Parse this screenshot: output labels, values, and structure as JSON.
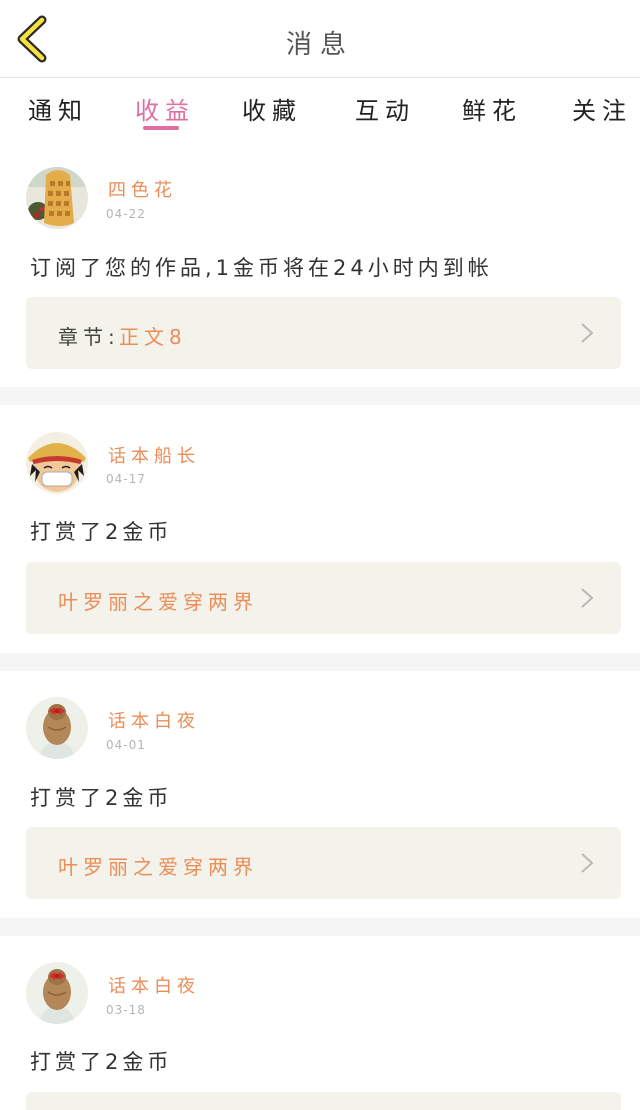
{
  "header": {
    "title": "消息"
  },
  "tabs": [
    {
      "label": "通知",
      "active": false
    },
    {
      "label": "收益",
      "active": true
    },
    {
      "label": "收藏",
      "active": false
    },
    {
      "label": "互动",
      "active": false
    },
    {
      "label": "鲜花",
      "active": false
    },
    {
      "label": "关注",
      "active": false
    }
  ],
  "messages": [
    {
      "user": "四色花",
      "date": "04-22",
      "text": "订阅了您的作品,1金币将在24小时内到帐",
      "link_prefix": "章节:",
      "link_text": "正文8",
      "avatar": "waffle-avatar"
    },
    {
      "user": "话本船长",
      "date": "04-17",
      "text": "打赏了2金币",
      "link_prefix": "",
      "link_text": "叶罗丽之爱穿两界",
      "avatar": "cartoon-boy-avatar"
    },
    {
      "user": "话本白夜",
      "date": "04-01",
      "text": "打赏了2金币",
      "link_prefix": "",
      "link_text": "叶罗丽之爱穿两界",
      "avatar": "girl-bun-avatar"
    },
    {
      "user": "话本白夜",
      "date": "03-18",
      "text": "打赏了2金币",
      "link_prefix": "",
      "link_text": "",
      "avatar": "girl-bun-avatar"
    }
  ],
  "colors": {
    "accent_pink": "#e06ea0",
    "accent_orange": "#ec8d58",
    "back_icon_yellow": "#f5e23c",
    "link_box_bg": "#f3f3ec",
    "separator_bg": "#f5f5f5"
  }
}
